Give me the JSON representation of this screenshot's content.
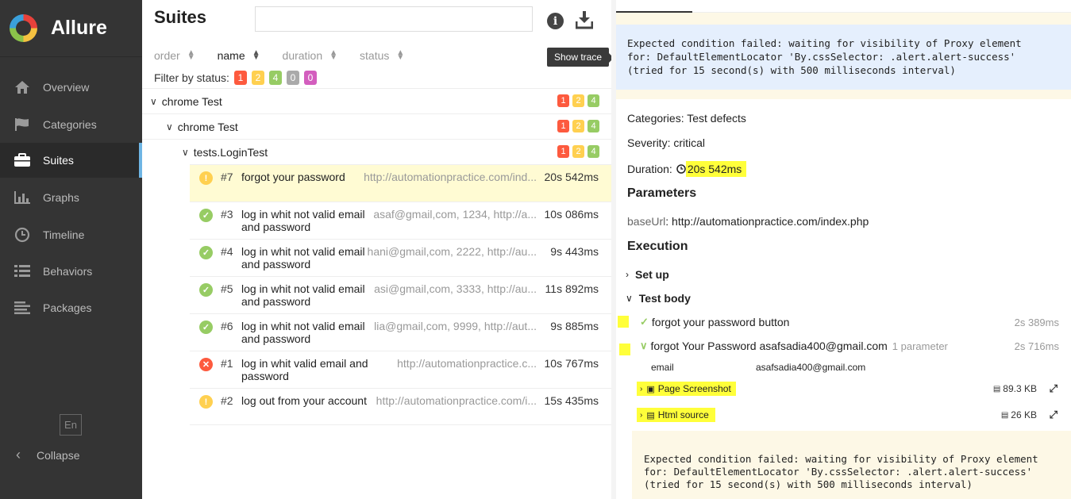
{
  "app": {
    "name": "Allure"
  },
  "sidebar": {
    "items": [
      {
        "label": "Overview",
        "icon": "home-icon"
      },
      {
        "label": "Categories",
        "icon": "flag-icon"
      },
      {
        "label": "Suites",
        "icon": "briefcase-icon"
      },
      {
        "label": "Graphs",
        "icon": "bar-chart-icon"
      },
      {
        "label": "Timeline",
        "icon": "clock-icon"
      },
      {
        "label": "Behaviors",
        "icon": "list-icon"
      },
      {
        "label": "Packages",
        "icon": "align-left-icon"
      }
    ],
    "active": "Suites",
    "lang": "En",
    "collapse": "Collapse"
  },
  "suites": {
    "title": "Suites",
    "search_value": "",
    "sort": [
      {
        "label": "order"
      },
      {
        "label": "name"
      },
      {
        "label": "duration"
      },
      {
        "label": "status"
      }
    ],
    "active_sort": "name",
    "filter_label": "Filter by status:",
    "filter_badges": [
      "1",
      "2",
      "4",
      "0",
      "0"
    ],
    "tree": [
      {
        "name": "chrome Test",
        "badges": [
          "1",
          "2",
          "4"
        ]
      },
      {
        "name": "chrome Test",
        "badges": [
          "1",
          "2",
          "4"
        ]
      },
      {
        "name": "tests.LoginTest",
        "badges": [
          "1",
          "2",
          "4"
        ]
      }
    ],
    "tests": [
      {
        "num": "#7",
        "title": "forgot your password",
        "param": "http://automationpractice.com/ind...",
        "duration": "20s 542ms",
        "status": "broken",
        "selected": true
      },
      {
        "num": "#3",
        "title": "log in whit not valid email and password",
        "param": "asaf@gmail,com, 1234, http://a...",
        "duration": "10s 086ms",
        "status": "passed"
      },
      {
        "num": "#4",
        "title": "log in whit not valid email and password",
        "param": "hani@gmail,com, 2222, http://au...",
        "duration": "9s 443ms",
        "status": "passed"
      },
      {
        "num": "#5",
        "title": "log in whit not valid email and password",
        "param": "asi@gmail,com, 3333, http://au...",
        "duration": "11s 892ms",
        "status": "passed"
      },
      {
        "num": "#6",
        "title": "log in whit not valid email and password",
        "param": "lia@gmail,com, 9999, http://aut...",
        "duration": "9s 885ms",
        "status": "passed"
      },
      {
        "num": "#1",
        "title": "log in whit valid email and password",
        "param": "http://automationpractice.c...",
        "duration": "10s 767ms",
        "status": "failed"
      },
      {
        "num": "#2",
        "title": "log out from your account",
        "param": "http://automationpractice.com/i...",
        "duration": "15s 435ms",
        "status": "broken"
      }
    ],
    "tooltip": "Show trace"
  },
  "details": {
    "error_message": "Expected condition failed: waiting for visibility of Proxy element\nfor: DefaultElementLocator 'By.cssSelector: .alert.alert-success'\n(tried for 15 second(s) with 500 milliseconds interval)",
    "categories": "Categories: Test defects",
    "severity": "Severity: critical",
    "duration_label": "Duration:",
    "duration_value": "20s 542ms",
    "parameters_title": "Parameters",
    "param_key": "baseUrl",
    "param_value": ": http://automationpractice.com/index.php",
    "execution_title": "Execution",
    "setup_label": "Set up",
    "testbody_label": "Test body",
    "steps": [
      {
        "name": "forgot your password button",
        "duration": "2s 389ms"
      },
      {
        "name": "forgot Your Password asafsadia400@gmail.com",
        "param_count": "1 parameter",
        "duration": "2s 716ms"
      }
    ],
    "step_param": {
      "key": "email",
      "value": "asafsadia400@gmail.com"
    },
    "attachments": [
      {
        "name": "Page Screenshot",
        "size": "89.3 KB"
      },
      {
        "name": "Html source",
        "size": "26 KB"
      }
    ],
    "step_error": "Expected condition failed: waiting for visibility of Proxy element\nfor: DefaultElementLocator 'By.cssSelector: .alert.alert-success'\n(tried for 15 second(s) with 500 milliseconds interval)"
  }
}
